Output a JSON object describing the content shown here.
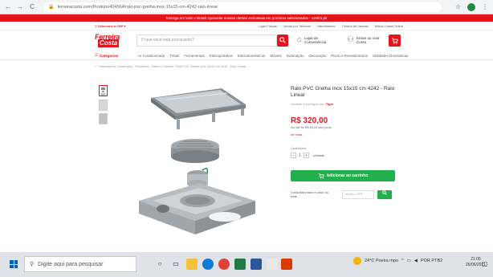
{
  "browser": {
    "url": "ferreiracosta.com/Produto/404564/ralo-pvc-grelha-inox-15x15-cm-4242-ralo-linear",
    "nav_back": "←",
    "nav_forward": "→",
    "nav_reload": "C",
    "lock": "🔒",
    "star": "☆",
    "menu": "⋮"
  },
  "announcement": "Entrega em todo o Brasil! Aproveite nossas ofertas exclusivas em produtos selecionados - confira já!",
  "toplinks": {
    "cep_label": "⚲ Selecione o CEP ▾",
    "links": [
      "Lojas Físicas",
      "Venda por Telefone",
      "Atendimento",
      "Central de Vendas",
      "Minha Conta Online"
    ]
  },
  "header": {
    "logo_line1": "Ferreira",
    "logo_line2": "Costa",
    "search_placeholder": "O que você está procurando?",
    "search_icon": "search-icon",
    "stores_label": "Lojas de Conveniência",
    "account_label": "Entrar ou criar Conta",
    "cart_icon": "cart-icon"
  },
  "catnav": {
    "categories_label": "Categorias",
    "items": [
      "Ar Condicionado",
      "Tintas",
      "Ferramentas",
      "Eletroportáteis",
      "Eletrodomésticos",
      "Móveis",
      "Iluminação",
      "Decoração",
      "Pisos e Revestimentos",
      "Utilidades Domésticas"
    ]
  },
  "breadcrumb": "⌂ › Materiais de Construção › Hidráulica › Ralos e Grelhas › Ralo PVC Grelha Inox 15x15 cm 4242 - Ralo Linear",
  "product": {
    "title": "Ralo PVC Grelha Inox 15x15 cm 4242 - Ralo Linear",
    "brand_caption": "Vendido e entregue por",
    "brand_logo": "Tigre",
    "price": "R$ 320,00",
    "installments": "em até 5x R$ 64,00 sem juros",
    "more_options": "ver mais",
    "qty_label": "Quantidade",
    "qty_value": "1",
    "qty_minus": "−",
    "qty_plus": "+",
    "qty_unit": "Unidade",
    "add_to_cart": "Adicionar ao carrinho",
    "shipping_label": "Consultar prazo e valor do frete",
    "cep_placeholder": "Insira o CEP",
    "shipping_icon": "search-icon"
  },
  "taskbar": {
    "search_placeholder": "Digite aqui para pesquisar",
    "weather": "24°C Poeira mpo",
    "language": "POR PTB2",
    "time": "21:05",
    "date": "26/06/2021"
  }
}
